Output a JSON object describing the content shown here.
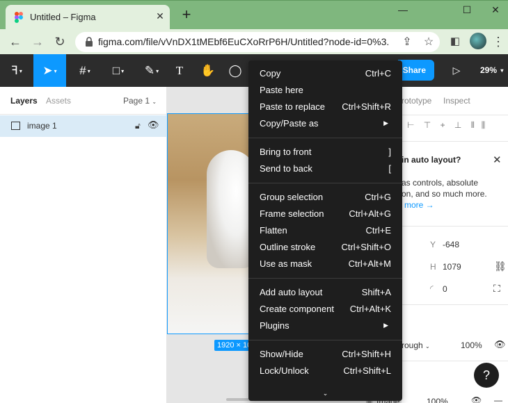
{
  "browser": {
    "tab_title": "Untitled – Figma",
    "tab_close": "✕",
    "new_tab": "+",
    "window_controls": {
      "minimize": "—",
      "maximize": "☐",
      "close": "✕"
    },
    "url": "figma.com/file/vVnDX1tMEbf6EuCXoRrP6H/Untitled?node-id=0%3..."
  },
  "toolbar": {
    "share_label": "Share",
    "zoom_level": "29%"
  },
  "left_panel": {
    "tabs": [
      "Layers",
      "Assets"
    ],
    "page_selector": "Page 1",
    "layers": [
      {
        "name": "image 1"
      }
    ]
  },
  "canvas": {
    "size_badge": "1920 × 10"
  },
  "right_panel": {
    "tabs": [
      "rototype",
      "Inspect"
    ],
    "promo_title": "in auto layout?",
    "promo_line1": "as controls, absolute",
    "promo_line2": "on, and so much more.",
    "promo_link": "more →",
    "y_label": "Y",
    "y_value": "-648",
    "h_label": "H",
    "h_value": "1079",
    "radius_value": "0",
    "blend_mode": "rough",
    "opacity": "100%",
    "fill_name": "Image",
    "fill_opacity": "100%",
    "help": "?"
  },
  "context_menu": {
    "groups": [
      [
        {
          "label": "Copy",
          "shortcut": "Ctrl+C"
        },
        {
          "label": "Paste here",
          "shortcut": ""
        },
        {
          "label": "Paste to replace",
          "shortcut": "Ctrl+Shift+R"
        },
        {
          "label": "Copy/Paste as",
          "shortcut": "▶"
        }
      ],
      [
        {
          "label": "Bring to front",
          "shortcut": "]"
        },
        {
          "label": "Send to back",
          "shortcut": "["
        }
      ],
      [
        {
          "label": "Group selection",
          "shortcut": "Ctrl+G"
        },
        {
          "label": "Frame selection",
          "shortcut": "Ctrl+Alt+G"
        },
        {
          "label": "Flatten",
          "shortcut": "Ctrl+E"
        },
        {
          "label": "Outline stroke",
          "shortcut": "Ctrl+Shift+O"
        },
        {
          "label": "Use as mask",
          "shortcut": "Ctrl+Alt+M"
        }
      ],
      [
        {
          "label": "Add auto layout",
          "shortcut": "Shift+A"
        },
        {
          "label": "Create component",
          "shortcut": "Ctrl+Alt+K"
        },
        {
          "label": "Plugins",
          "shortcut": "▶"
        }
      ],
      [
        {
          "label": "Show/Hide",
          "shortcut": "Ctrl+Shift+H"
        },
        {
          "label": "Lock/Unlock",
          "shortcut": "Ctrl+Shift+L"
        }
      ]
    ],
    "more_indicator": "⌄"
  },
  "colors": {
    "browser_frame": "#7fb77e",
    "figma_toolbar": "#2c2c2c",
    "figma_accent": "#0d99ff",
    "menu_bg": "#1e1e1e"
  }
}
